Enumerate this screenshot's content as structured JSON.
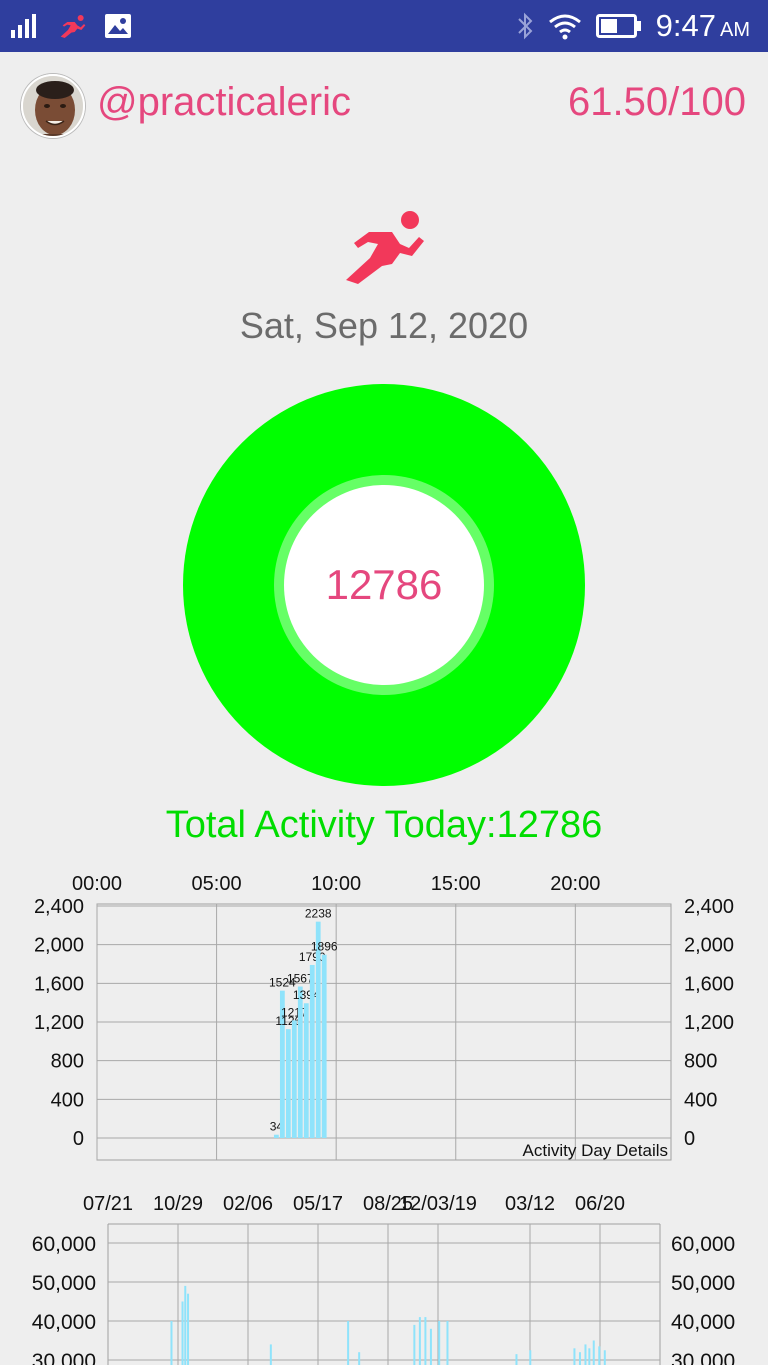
{
  "status_bar": {
    "time": "9:47",
    "ampm": "AM",
    "icons": [
      "signal-icon",
      "runner-notification-icon",
      "image-notification-icon",
      "bluetooth-icon",
      "wifi-icon",
      "battery-icon"
    ]
  },
  "profile": {
    "username": "@practicaleric",
    "score": "61.50/100"
  },
  "date": "Sat, Sep 12, 2020",
  "ring": {
    "value": "12786",
    "progress": 1.0
  },
  "total_label": "Total Activity Today:12786",
  "colors": {
    "status_bar": "#2f3e9e",
    "accent_pink": "#e5477e",
    "ring_green": "#00ff00",
    "total_text": "#00dd00",
    "bar_blue": "#8fe3fb"
  },
  "chart_data": [
    {
      "type": "bar",
      "title": "Activity Day Details",
      "x_ticks": [
        "00:00",
        "05:00",
        "10:00",
        "15:00",
        "20:00"
      ],
      "x_range_hours": [
        0,
        24
      ],
      "y_ticks": [
        "0",
        "400",
        "800",
        "1,200",
        "1,600",
        "2,000",
        "2,400"
      ],
      "ylim": [
        0,
        2400
      ],
      "grid": true,
      "points": [
        {
          "hour": 7.5,
          "value": 34,
          "label": "34"
        },
        {
          "hour": 7.75,
          "value": 1524,
          "label": "1524"
        },
        {
          "hour": 8.0,
          "value": 1126,
          "label": "1126"
        },
        {
          "hour": 8.25,
          "value": 1217,
          "label": "1217"
        },
        {
          "hour": 8.5,
          "value": 1567,
          "label": "1567"
        },
        {
          "hour": 8.75,
          "value": 1394,
          "label": "1394"
        },
        {
          "hour": 9.0,
          "value": 1790,
          "label": "1790"
        },
        {
          "hour": 9.25,
          "value": 2238,
          "label": "2238"
        },
        {
          "hour": 9.5,
          "value": 1896,
          "label": "1896"
        }
      ]
    },
    {
      "type": "bar",
      "x_ticks": [
        "07/21",
        "10/29",
        "02/06",
        "05/17",
        "08/25",
        "12/03/19",
        "03/12",
        "06/20"
      ],
      "y_ticks": [
        "30,000",
        "40,000",
        "50,000",
        "60,000"
      ],
      "ylim": [
        30000,
        65000
      ],
      "grid": true,
      "points": [
        {
          "pos": 0.115,
          "value": 40000
        },
        {
          "pos": 0.135,
          "value": 45000
        },
        {
          "pos": 0.14,
          "value": 49000
        },
        {
          "pos": 0.145,
          "value": 47000
        },
        {
          "pos": 0.295,
          "value": 34000
        },
        {
          "pos": 0.435,
          "value": 40000
        },
        {
          "pos": 0.455,
          "value": 32000
        },
        {
          "pos": 0.555,
          "value": 39000
        },
        {
          "pos": 0.565,
          "value": 41000
        },
        {
          "pos": 0.575,
          "value": 41000
        },
        {
          "pos": 0.585,
          "value": 38000
        },
        {
          "pos": 0.6,
          "value": 40000
        },
        {
          "pos": 0.615,
          "value": 40000
        },
        {
          "pos": 0.74,
          "value": 31500
        },
        {
          "pos": 0.765,
          "value": 32500
        },
        {
          "pos": 0.845,
          "value": 33000
        },
        {
          "pos": 0.855,
          "value": 32000
        },
        {
          "pos": 0.865,
          "value": 34000
        },
        {
          "pos": 0.872,
          "value": 33000
        },
        {
          "pos": 0.88,
          "value": 35000
        },
        {
          "pos": 0.89,
          "value": 33500
        },
        {
          "pos": 0.9,
          "value": 32500
        }
      ]
    }
  ]
}
